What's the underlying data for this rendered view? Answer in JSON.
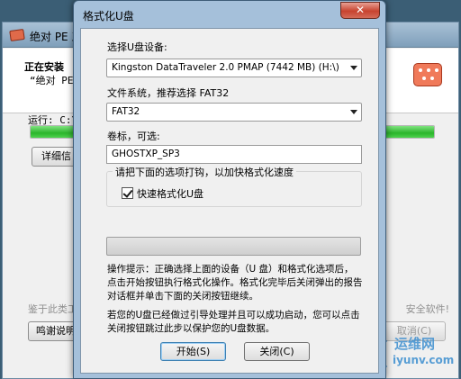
{
  "background_window": {
    "title": "绝对 PE 工",
    "heading": "正在安装",
    "subheading": "“绝对 PE",
    "run_label": "运行: C:\\",
    "details_button": "详细信",
    "footer_text": "鉴于此类工",
    "footer_text_right": "安全软件!",
    "thanks_button": "鸣谢说明",
    "cancel_button": "取消(C)",
    "progress_fraction": 1.0
  },
  "dialog": {
    "title": "格式化U盘",
    "close_glyph": "✕",
    "device_label": "选择U盘设备:",
    "device_value": "Kingston DataTraveler 2.0 PMAP (7442 MB) (H:\\)",
    "filesystem_label": "文件系统，推荐选择 FAT32",
    "filesystem_value": "FAT32",
    "volume_label": "卷标，可选:",
    "volume_value": "GHOSTXP_SP3",
    "options_legend": "请把下面的选项打钩，以加快格式化速度",
    "quick_format_label": "快速格式化U盘",
    "quick_format_checked": true,
    "progress_fraction": 0,
    "tip_text": "操作提示：正确选择上面的设备（U 盘）和格式化选项后，点击开始按钮执行格式化操作。格式化完毕后关闭弹出的报告对话框并单击下面的关闭按钮继续。",
    "skip_text": "若您的U盘已经做过引导处理并且可以成功启动，您可以点击关闭按钮跳过此步以保护您的U盘数据。",
    "start_button": "开始(S)",
    "close_button": "关闭(C)"
  },
  "watermark": {
    "title": "运维网",
    "url": "iyunv.com"
  }
}
